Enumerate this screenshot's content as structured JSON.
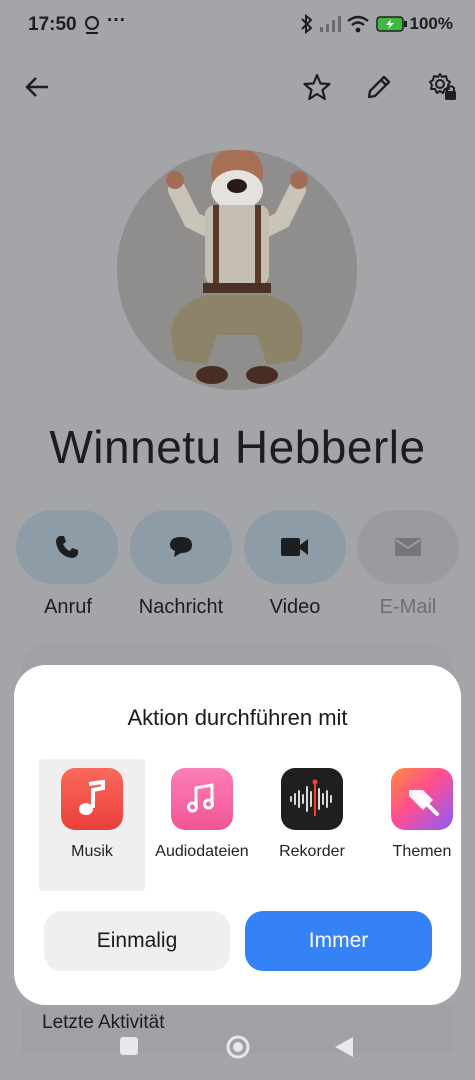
{
  "status_bar": {
    "time": "17:50",
    "battery": "100%",
    "more": "···"
  },
  "contact": {
    "name": "Winnetu Hebberle"
  },
  "actions": [
    {
      "label": "Anruf",
      "icon": "phone-icon",
      "enabled": true
    },
    {
      "label": "Nachricht",
      "icon": "message-icon",
      "enabled": true
    },
    {
      "label": "Video",
      "icon": "video-icon",
      "enabled": true
    },
    {
      "label": "E-Mail",
      "icon": "mail-icon",
      "enabled": false
    }
  ],
  "sheet": {
    "title": "Aktion durchführen mit",
    "apps": [
      {
        "label": "Musik",
        "icon": "music-note-icon",
        "selected": true
      },
      {
        "label": "Audiodateien",
        "icon": "audio-files-icon",
        "selected": false
      },
      {
        "label": "Rekorder",
        "icon": "recorder-icon",
        "selected": false
      },
      {
        "label": "Themen",
        "icon": "themes-icon",
        "selected": false
      }
    ],
    "once_label": "Einmalig",
    "always_label": "Immer"
  },
  "recent_activity": {
    "label": "Letzte Aktivität"
  },
  "colors": {
    "accent": "#3482f6",
    "scrim": "#a4a5a9"
  }
}
